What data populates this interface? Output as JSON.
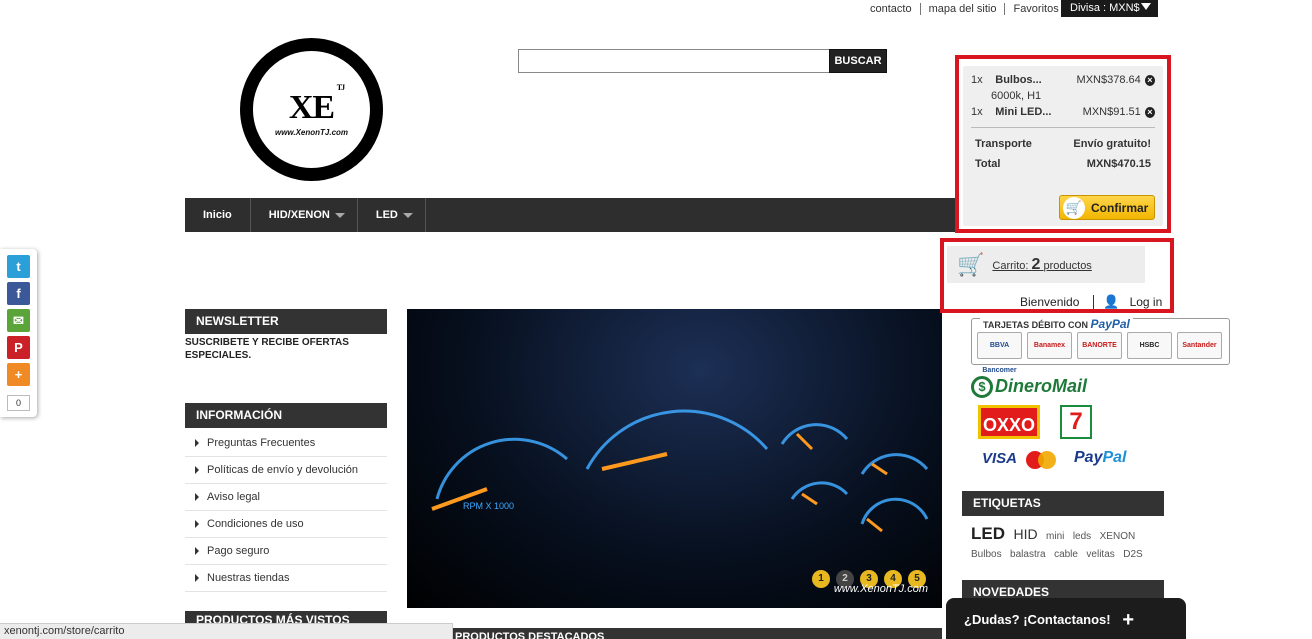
{
  "top_links": [
    "contacto",
    "mapa del sitio",
    "Favoritos"
  ],
  "currency": "Divisa : MXN$",
  "logo": {
    "mark": "XE",
    "sup": "TJ",
    "url": "www.XenonTJ.com"
  },
  "search": {
    "button": "BUSCAR",
    "value": ""
  },
  "nav": [
    {
      "label": "Inicio"
    },
    {
      "label": "HID/XENON"
    },
    {
      "label": "LED"
    }
  ],
  "share": {
    "count": "0",
    "icons": [
      "twitter-icon",
      "facebook-icon",
      "email-icon",
      "pinterest-icon",
      "more-icon"
    ]
  },
  "newsletter": {
    "title": "NEWSLETTER",
    "text": "SUSCRIBETE Y RECIBE OFERTAS ESPECIALES."
  },
  "informacion": {
    "title": "INFORMACIÓN",
    "items": [
      "Preguntas Frecuentes",
      "Políticas de envío y devolución",
      "Aviso legal",
      "Condiciones de uso",
      "Pago seguro",
      "Nuestras tiendas"
    ]
  },
  "productos_mas_vistos": "PRODUCTOS MÁS VISTOS",
  "slider": {
    "dots": [
      "1",
      "2",
      "3",
      "4",
      "5"
    ],
    "active_dot": 2,
    "watermark": "www.XenonTJ.com",
    "rpm_label": "RPM X 1000"
  },
  "featured": "PRODUCTOS DESTACADOS",
  "cart_popup": {
    "items": [
      {
        "qty": "1x",
        "name": "Bulbos...",
        "price": "MXN$378.64",
        "attr": "6000k, H1"
      },
      {
        "qty": "1x",
        "name": "Mini LED...",
        "price": "MXN$91.51",
        "attr": ""
      }
    ],
    "shipping_label": "Transporte",
    "shipping_value": "Envío gratuito!",
    "total_label": "Total",
    "total_value": "MXN$470.15",
    "confirm": "Confirmar"
  },
  "cart_summary": {
    "prefix": "Carrito:",
    "count": "2",
    "suffix": "productos",
    "welcome": "Bienvenido",
    "login": "Log in"
  },
  "payment": {
    "debit_label": "TARJETAS DÉBITO CON",
    "debit_brand": "PayPal",
    "banks": [
      "BBVA Bancomer",
      "Banamex",
      "BANORTE",
      "HSBC",
      "Santander"
    ],
    "dineromail": "DineroMail",
    "oxxo": "OXXO",
    "seven": "7",
    "visa": "VISA",
    "mastercard": "MasterCard",
    "paypal_a": "Pay",
    "paypal_b": "Pal"
  },
  "etiquetas": {
    "title": "ETIQUETAS",
    "tags": [
      {
        "t": "LED",
        "size": 17
      },
      {
        "t": "HID",
        "size": 14
      },
      {
        "t": "mini",
        "size": 10
      },
      {
        "t": "leds",
        "size": 10
      },
      {
        "t": "XENON",
        "size": 10
      },
      {
        "t": "Bulbos",
        "size": 10
      },
      {
        "t": "balastra",
        "size": 10
      },
      {
        "t": "cable",
        "size": 10
      },
      {
        "t": "velitas",
        "size": 10
      },
      {
        "t": "D2S",
        "size": 10
      }
    ]
  },
  "novedades": "NOVEDADES",
  "status_url": "xenontj.com/store/carrito",
  "contact_bar": "¿Dudas? ¡Contactanos!",
  "colors": {
    "accent_red": "#d9151f",
    "dark_bar": "#333333",
    "confirm_yellow": "#f2b600"
  }
}
